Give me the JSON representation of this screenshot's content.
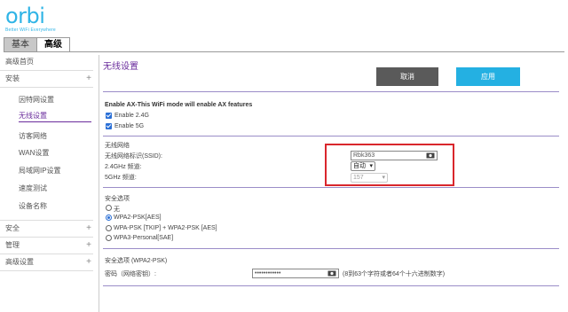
{
  "brand": {
    "logo": "orbi",
    "tagline": "Better WiFi Everywhere"
  },
  "tabs": [
    {
      "label": "基本"
    },
    {
      "label": "高级"
    }
  ],
  "sidebar": {
    "items": [
      {
        "label": "高级首页"
      },
      {
        "label": "安装"
      },
      {
        "label": "安全"
      },
      {
        "label": "管理"
      },
      {
        "label": "高级设置"
      }
    ],
    "sub_items": [
      {
        "label": "因特网设置"
      },
      {
        "label": "无线设置"
      },
      {
        "label": "访客网络"
      },
      {
        "label": "WAN设置"
      },
      {
        "label": "局域网IP设置"
      },
      {
        "label": "速度测试"
      },
      {
        "label": "设备名称"
      }
    ],
    "plus": "+"
  },
  "main": {
    "title": "无线设置",
    "cancel": "取消",
    "apply": "应用",
    "ax_heading": "Enable AX-This WiFi mode will enable AX features",
    "ax_24": "Enable 2.4G",
    "ax_5": "Enable 5G",
    "network_heading": "无线网络",
    "ssid_label": "无线网络标识(SSID):",
    "ssid_value": "Rbk363",
    "ch24_label": "2.4GHz 频道:",
    "ch24_value": "自动",
    "ch5_label": "5GHz 频道:",
    "ch5_value": "157",
    "security_heading": "安全选项",
    "security_options": [
      {
        "label": "无",
        "selected": false
      },
      {
        "label": "WPA2-PSK[AES]",
        "selected": true
      },
      {
        "label": "WPA-PSK [TKIP] + WPA2-PSK [AES]",
        "selected": false
      },
      {
        "label": "WPA3-Personal[SAE]",
        "selected": false
      }
    ],
    "sec_wpa2_heading": "安全选项 (WPA2-PSK)",
    "password_label": "密码（网络密钥）:",
    "password_value": "••••••••••••",
    "password_hint": "(8到63个字符或者64个十六进制数字)"
  },
  "colors": {
    "accent": "#6a2c9c",
    "apply": "#24b0e2",
    "cancel": "#5a5a5a",
    "highlight": "#d9262c",
    "logo": "#2fb4e6"
  },
  "icons": {
    "eye": "eye-icon",
    "plus": "plus-icon",
    "chevron": "chevron-down-icon"
  }
}
